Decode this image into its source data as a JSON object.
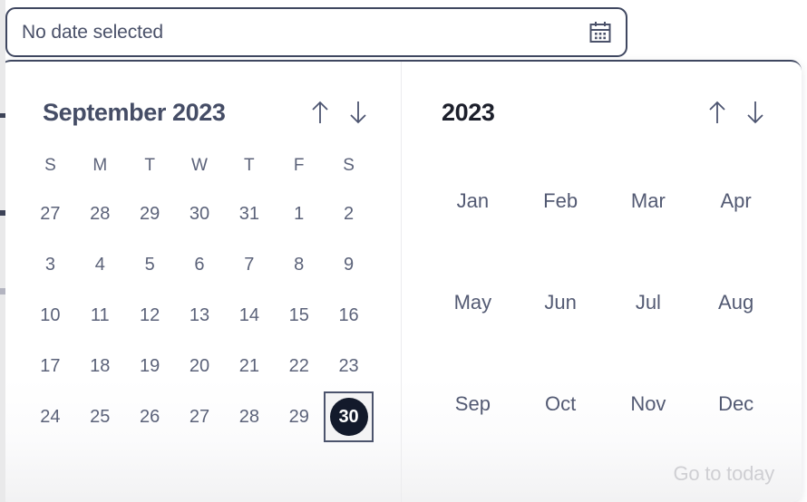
{
  "input": {
    "value": "No date selected",
    "placeholder": "No date selected",
    "icon": "calendar-icon",
    "border_color": "#3f4760"
  },
  "day_panel": {
    "title": "September 2023",
    "month": "September",
    "year": "2023",
    "prev_icon": "arrow-up-icon",
    "next_icon": "arrow-down-icon",
    "weekdays": [
      "S",
      "M",
      "T",
      "W",
      "T",
      "F",
      "S"
    ],
    "weeks": [
      [
        "27",
        "28",
        "29",
        "30",
        "31",
        "1",
        "2"
      ],
      [
        "3",
        "4",
        "5",
        "6",
        "7",
        "8",
        "9"
      ],
      [
        "10",
        "11",
        "12",
        "13",
        "14",
        "15",
        "16"
      ],
      [
        "17",
        "18",
        "19",
        "20",
        "21",
        "22",
        "23"
      ],
      [
        "24",
        "25",
        "26",
        "27",
        "28",
        "29",
        "30"
      ]
    ],
    "selected_day": "30",
    "selected_row": 4,
    "selected_col": 6,
    "selected_bg": "#131a2b",
    "selected_text": "#ffffff"
  },
  "month_panel": {
    "title": "2023",
    "prev_icon": "arrow-up-icon",
    "next_icon": "arrow-down-icon",
    "months": [
      "Jan",
      "Feb",
      "Mar",
      "Apr",
      "May",
      "Jun",
      "Jul",
      "Aug",
      "Sep",
      "Oct",
      "Nov",
      "Dec"
    ],
    "go_to_today_label": "Go to today",
    "go_to_today_color": "#cfcfd3"
  },
  "colors": {
    "text": "#5b6279",
    "title": "#454d66",
    "year_title": "#1c1f2b",
    "divider": "#ececee",
    "panel_bg": "#ffffff"
  }
}
